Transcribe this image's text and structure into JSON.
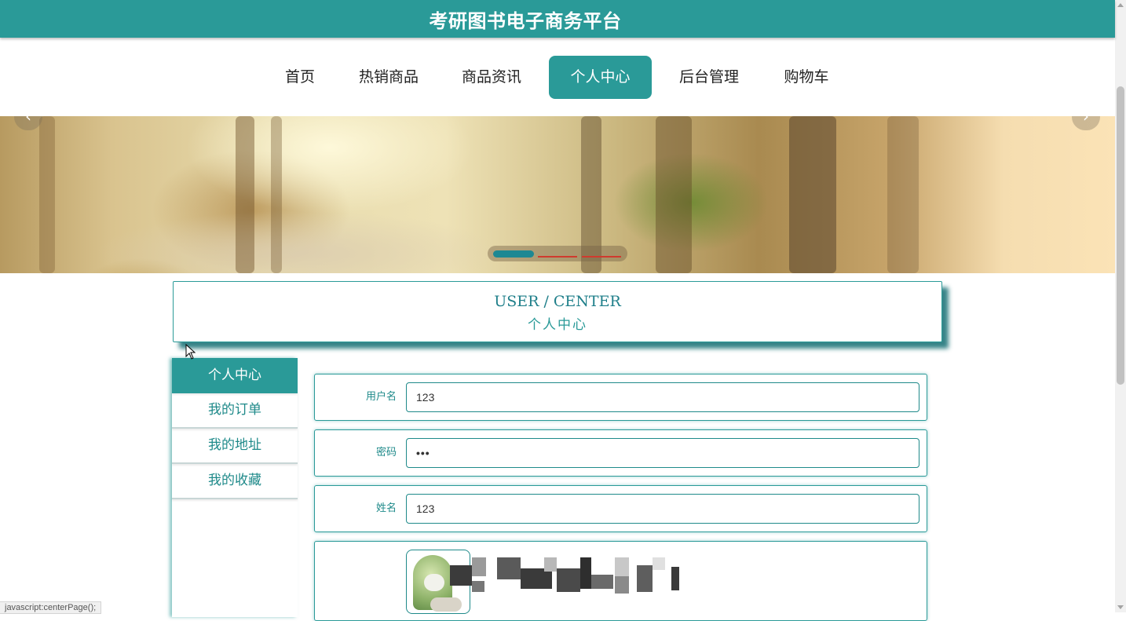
{
  "header": {
    "title": "考研图书电子商务平台"
  },
  "nav": {
    "items": [
      {
        "label": "首页"
      },
      {
        "label": "热销商品"
      },
      {
        "label": "商品资讯"
      },
      {
        "label": "个人中心",
        "active": true
      },
      {
        "label": "后台管理"
      },
      {
        "label": "购物车"
      }
    ]
  },
  "banner": {
    "prev_icon": "chevron-left-icon",
    "next_icon": "chevron-right-icon",
    "slides": 3,
    "active_slide": 1
  },
  "section": {
    "title_en": "USER / CENTER",
    "title_zh": "个人中心"
  },
  "sidebar": {
    "items": [
      {
        "label": "个人中心",
        "active": true
      },
      {
        "label": "我的订单"
      },
      {
        "label": "我的地址"
      },
      {
        "label": "我的收藏"
      }
    ]
  },
  "form": {
    "username": {
      "label": "用户名",
      "value": "123"
    },
    "password": {
      "label": "密码",
      "value": "•••"
    },
    "name": {
      "label": "姓名",
      "value": "123"
    }
  },
  "status_bar": {
    "text": "javascript:centerPage();"
  },
  "colors": {
    "primary": "#2a9a98",
    "accent_dark": "#1f8a8a",
    "dot_active": "#1d8893",
    "dot_inactive": "#d03a2e"
  }
}
